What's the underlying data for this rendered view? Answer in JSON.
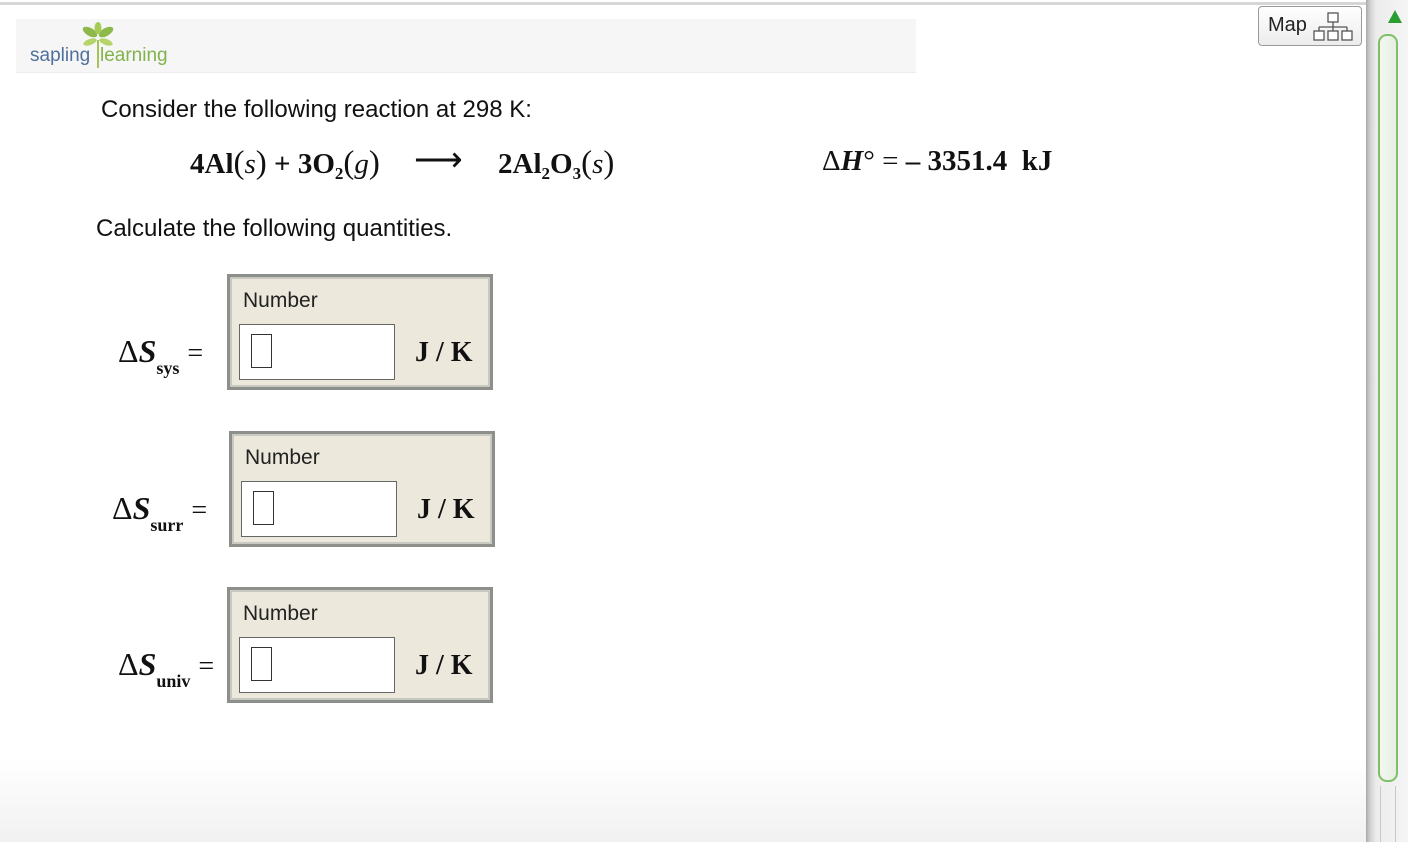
{
  "header": {
    "logo_word1": "sapling",
    "logo_word2": "learning",
    "map_label": "Map"
  },
  "problem": {
    "intro": "Consider the following reaction at 298 K:",
    "reaction": {
      "r1_coef": "4",
      "r1_species": "Al",
      "r1_state": "s",
      "plus": "+",
      "r2_coef": "3",
      "r2_species": "O",
      "r2_sub": "2",
      "r2_state": "g",
      "arrow": "⟶",
      "p1_coef": "2",
      "p1_species_a": "Al",
      "p1_sub_a": "2",
      "p1_species_b": "O",
      "p1_sub_b": "3",
      "p1_state": "s"
    },
    "enthalpy": {
      "symbol_delta": "Δ",
      "symbol_H": "H",
      "degree": "°",
      "equals": "=",
      "value": "– 3351.4",
      "unit": "kJ"
    },
    "instruction": "Calculate the following quantities."
  },
  "answers": [
    {
      "delta": "Δ",
      "symbol": "S",
      "subscript": "sys",
      "equals": "=",
      "caption": "Number",
      "value": "",
      "unit": "J / K"
    },
    {
      "delta": "Δ",
      "symbol": "S",
      "subscript": "surr",
      "equals": "=",
      "caption": "Number",
      "value": "",
      "unit": "J / K"
    },
    {
      "delta": "Δ",
      "symbol": "S",
      "subscript": "univ",
      "equals": "=",
      "caption": "Number",
      "value": "",
      "unit": "J / K"
    }
  ],
  "colors": {
    "panel_bg": "#ece9dc",
    "panel_border": "#8d8f8a",
    "logo_blue": "#4f6f9c",
    "logo_green": "#82b24a",
    "scroll_green": "#2a9d2f"
  },
  "icons": {
    "logo_sprout": "sprout-icon",
    "map": "sitemap-icon",
    "scroll_up": "triangle-up-icon"
  }
}
